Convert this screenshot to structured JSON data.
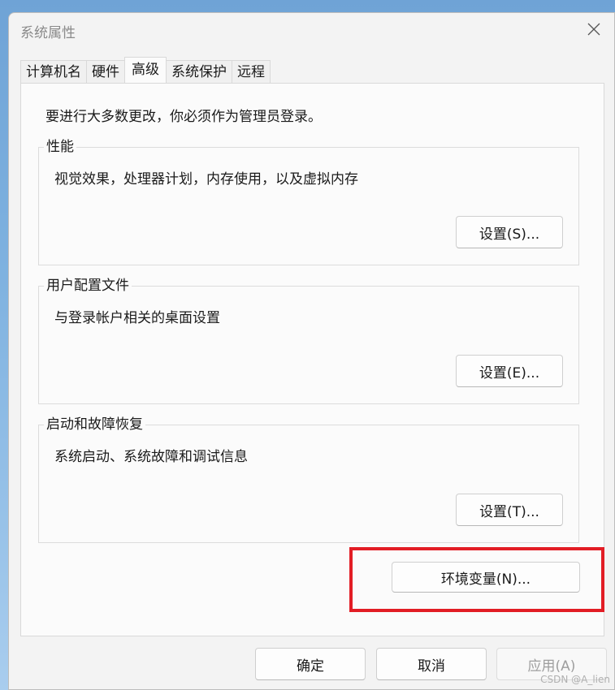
{
  "window": {
    "title": "系统属性"
  },
  "tabs": [
    {
      "label": "计算机名"
    },
    {
      "label": "硬件"
    },
    {
      "label": "高级"
    },
    {
      "label": "系统保护"
    },
    {
      "label": "远程"
    }
  ],
  "advanced": {
    "admin_note": "要进行大多数更改，你必须作为管理员登录。",
    "performance": {
      "title": "性能",
      "description": "视觉效果，处理器计划，内存使用，以及虚拟内存",
      "button_label": "设置(S)..."
    },
    "user_profiles": {
      "title": "用户配置文件",
      "description": "与登录帐户相关的桌面设置",
      "button_label": "设置(E)..."
    },
    "startup_recovery": {
      "title": "启动和故障恢复",
      "description": "系统启动、系统故障和调试信息",
      "button_label": "设置(T)..."
    },
    "env_button_label": "环境变量(N)..."
  },
  "footer": {
    "ok_label": "确定",
    "cancel_label": "取消",
    "apply_label": "应用(A)"
  },
  "watermark": "CSDN @A_lien",
  "colors": {
    "highlight": "#e21d25"
  },
  "icons": {
    "close": "close-icon"
  }
}
